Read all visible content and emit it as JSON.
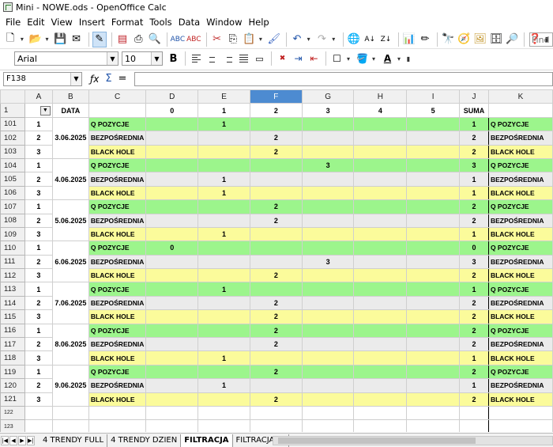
{
  "window": {
    "title": "Mini - NOWE.ods - OpenOffice Calc"
  },
  "menu": [
    {
      "label": "File",
      "key": "F"
    },
    {
      "label": "Edit",
      "key": "E"
    },
    {
      "label": "View",
      "key": "V"
    },
    {
      "label": "Insert",
      "key": "I"
    },
    {
      "label": "Format",
      "key": "o"
    },
    {
      "label": "Tools",
      "key": "T"
    },
    {
      "label": "Data",
      "key": "D"
    },
    {
      "label": "Window",
      "key": "W"
    },
    {
      "label": "Help",
      "key": "H"
    }
  ],
  "find": {
    "placeholder": "Find"
  },
  "format": {
    "font_name": "Arial",
    "font_size": "10"
  },
  "formula": {
    "cell_ref": "F138",
    "content": ""
  },
  "columns": [
    "A",
    "B",
    "C",
    "D",
    "E",
    "F",
    "G",
    "H",
    "I",
    "J",
    "K"
  ],
  "selected_column": "F",
  "header_row": {
    "row": "1",
    "A": "",
    "B": "DATA",
    "C": "",
    "D": "0",
    "E": "1",
    "F": "2",
    "G": "3",
    "H": "4",
    "I": "5",
    "J": "SUMA",
    "K": ""
  },
  "rows": [
    {
      "row": "101",
      "a": "1",
      "b": "3.06.2025",
      "c": "Q POZYCJE",
      "d": "",
      "e": "1",
      "f": "",
      "g": "",
      "h": "",
      "i": "",
      "j": "1",
      "k": "Q POZYCJE"
    },
    {
      "row": "102",
      "a": "2",
      "b": "",
      "c": "BEZPOŚREDNIA",
      "d": "",
      "e": "",
      "f": "2",
      "g": "",
      "h": "",
      "i": "",
      "j": "2",
      "k": "BEZPOŚREDNIA"
    },
    {
      "row": "103",
      "a": "3",
      "b": "",
      "c": "BLACK HOLE",
      "d": "",
      "e": "",
      "f": "2",
      "g": "",
      "h": "",
      "i": "",
      "j": "2",
      "k": "BLACK HOLE"
    },
    {
      "row": "104",
      "a": "1",
      "b": "4.06.2025",
      "c": "Q POZYCJE",
      "d": "",
      "e": "",
      "f": "",
      "g": "3",
      "h": "",
      "i": "",
      "j": "3",
      "k": "Q POZYCJE"
    },
    {
      "row": "105",
      "a": "2",
      "b": "",
      "c": "BEZPOŚREDNIA",
      "d": "",
      "e": "1",
      "f": "",
      "g": "",
      "h": "",
      "i": "",
      "j": "1",
      "k": "BEZPOŚREDNIA"
    },
    {
      "row": "106",
      "a": "3",
      "b": "",
      "c": "BLACK HOLE",
      "d": "",
      "e": "1",
      "f": "",
      "g": "",
      "h": "",
      "i": "",
      "j": "1",
      "k": "BLACK HOLE"
    },
    {
      "row": "107",
      "a": "1",
      "b": "5.06.2025",
      "c": "Q POZYCJE",
      "d": "",
      "e": "",
      "f": "2",
      "g": "",
      "h": "",
      "i": "",
      "j": "2",
      "k": "Q POZYCJE"
    },
    {
      "row": "108",
      "a": "2",
      "b": "",
      "c": "BEZPOŚREDNIA",
      "d": "",
      "e": "",
      "f": "2",
      "g": "",
      "h": "",
      "i": "",
      "j": "2",
      "k": "BEZPOŚREDNIA"
    },
    {
      "row": "109",
      "a": "3",
      "b": "",
      "c": "BLACK HOLE",
      "d": "",
      "e": "1",
      "f": "",
      "g": "",
      "h": "",
      "i": "",
      "j": "1",
      "k": "BLACK HOLE"
    },
    {
      "row": "110",
      "a": "1",
      "b": "6.06.2025",
      "c": "Q POZYCJE",
      "d": "0",
      "e": "",
      "f": "",
      "g": "",
      "h": "",
      "i": "",
      "j": "0",
      "k": "Q POZYCJE"
    },
    {
      "row": "111",
      "a": "2",
      "b": "",
      "c": "BEZPOŚREDNIA",
      "d": "",
      "e": "",
      "f": "",
      "g": "3",
      "h": "",
      "i": "",
      "j": "3",
      "k": "BEZPOŚREDNIA"
    },
    {
      "row": "112",
      "a": "3",
      "b": "",
      "c": "BLACK HOLE",
      "d": "",
      "e": "",
      "f": "2",
      "g": "",
      "h": "",
      "i": "",
      "j": "2",
      "k": "BLACK HOLE"
    },
    {
      "row": "113",
      "a": "1",
      "b": "7.06.2025",
      "c": "Q POZYCJE",
      "d": "",
      "e": "1",
      "f": "",
      "g": "",
      "h": "",
      "i": "",
      "j": "1",
      "k": "Q POZYCJE"
    },
    {
      "row": "114",
      "a": "2",
      "b": "",
      "c": "BEZPOŚREDNIA",
      "d": "",
      "e": "",
      "f": "2",
      "g": "",
      "h": "",
      "i": "",
      "j": "2",
      "k": "BEZPOŚREDNIA"
    },
    {
      "row": "115",
      "a": "3",
      "b": "",
      "c": "BLACK HOLE",
      "d": "",
      "e": "",
      "f": "2",
      "g": "",
      "h": "",
      "i": "",
      "j": "2",
      "k": "BLACK HOLE"
    },
    {
      "row": "116",
      "a": "1",
      "b": "8.06.2025",
      "c": "Q POZYCJE",
      "d": "",
      "e": "",
      "f": "2",
      "g": "",
      "h": "",
      "i": "",
      "j": "2",
      "k": "Q POZYCJE"
    },
    {
      "row": "117",
      "a": "2",
      "b": "",
      "c": "BEZPOŚREDNIA",
      "d": "",
      "e": "",
      "f": "2",
      "g": "",
      "h": "",
      "i": "",
      "j": "2",
      "k": "BEZPOŚREDNIA"
    },
    {
      "row": "118",
      "a": "3",
      "b": "",
      "c": "BLACK HOLE",
      "d": "",
      "e": "1",
      "f": "",
      "g": "",
      "h": "",
      "i": "",
      "j": "1",
      "k": "BLACK HOLE"
    },
    {
      "row": "119",
      "a": "1",
      "b": "9.06.2025",
      "c": "Q POZYCJE",
      "d": "",
      "e": "",
      "f": "2",
      "g": "",
      "h": "",
      "i": "",
      "j": "2",
      "k": "Q POZYCJE"
    },
    {
      "row": "120",
      "a": "2",
      "b": "",
      "c": "BEZPOŚREDNIA",
      "d": "",
      "e": "1",
      "f": "",
      "g": "",
      "h": "",
      "i": "",
      "j": "1",
      "k": "BEZPOŚREDNIA"
    },
    {
      "row": "121",
      "a": "3",
      "b": "",
      "c": "BLACK HOLE",
      "d": "",
      "e": "",
      "f": "2",
      "g": "",
      "h": "",
      "i": "",
      "j": "2",
      "k": "BLACK HOLE"
    }
  ],
  "trailing_rows": [
    "122",
    "123",
    "124",
    "125"
  ],
  "sheet_tabs": [
    "4 TRENDY FULL",
    "4 TRENDY DZIEN",
    "FILTRACJA",
    "FILTRACJA DI"
  ],
  "active_tab": "FILTRACJA",
  "colors": {
    "q_pozycje": "#9cf58c",
    "bezposrednia": "#ebebeb",
    "black_hole": "#fbfb9b",
    "selected_column": "#4d8bd1"
  }
}
